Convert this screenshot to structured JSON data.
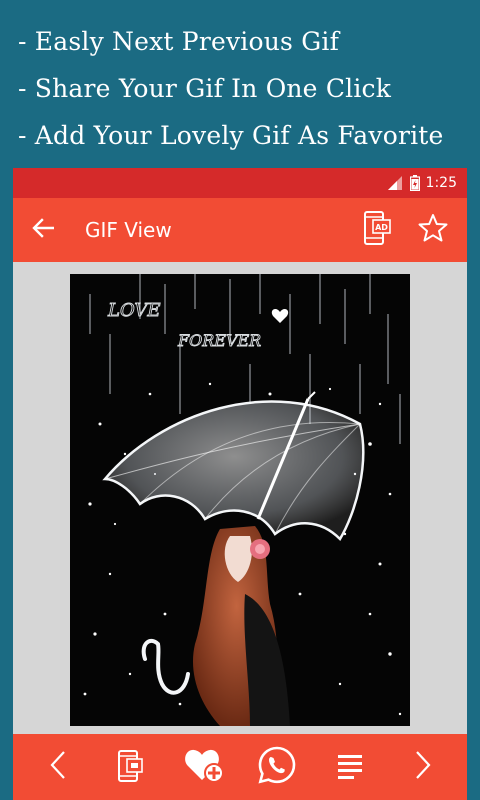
{
  "promo": {
    "lines": [
      "- Easly Next Previous Gif",
      "- Share Your Gif In One Click",
      "- Add Your Lovely Gif As Favorite"
    ]
  },
  "status_bar": {
    "time": "1:25",
    "icons": [
      "signal-icon",
      "battery-icon"
    ]
  },
  "toolbar": {
    "title": "GIF View",
    "back_icon": "back-arrow-icon",
    "actions": [
      "ad-phone-icon",
      "star-icon"
    ]
  },
  "gif": {
    "text_love": "LOVE",
    "text_forever": "FOREVER"
  },
  "bottom_bar": {
    "buttons": [
      "previous-icon",
      "copy-icon",
      "favorite-add-icon",
      "whatsapp-icon",
      "menu-icon",
      "next-icon"
    ]
  },
  "colors": {
    "background": "#1b6b83",
    "status_bar": "#d52a2a",
    "toolbar": "#f24c34",
    "content_bg": "#d6d6d6"
  }
}
